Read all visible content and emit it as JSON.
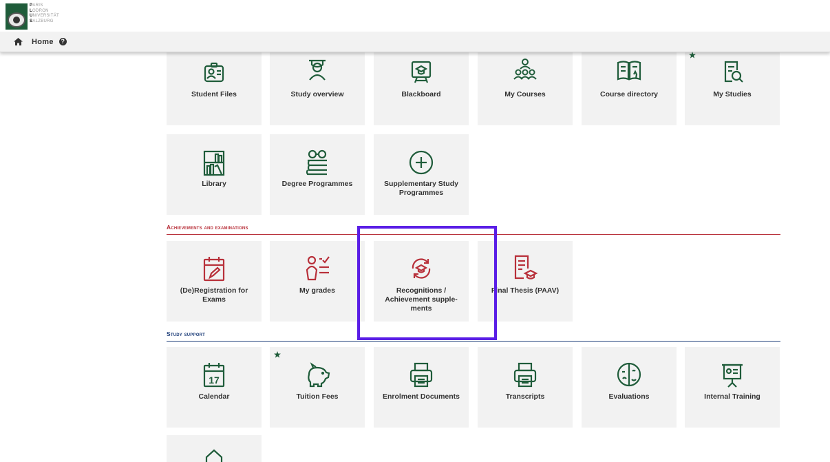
{
  "logo": {
    "letters": [
      "P",
      "L",
      "U",
      "S"
    ],
    "lines": [
      "ARIS",
      "ODRON",
      "NIVERSITÄT",
      "ALZBURG"
    ]
  },
  "nav": {
    "home_label": "Home",
    "help_symbol": "?"
  },
  "tiles_row1": [
    {
      "label": "Student Files",
      "icon": "student-id-icon"
    },
    {
      "label": "Study overview",
      "icon": "graduate-icon"
    },
    {
      "label": "Blackboard",
      "icon": "blackboard-icon"
    },
    {
      "label": "My Courses",
      "icon": "group-icon"
    },
    {
      "label": "Course directory",
      "icon": "open-book-icon"
    },
    {
      "label": "My Studies",
      "icon": "document-search-icon",
      "favourite": true
    }
  ],
  "tiles_row2": [
    {
      "label": "Library",
      "icon": "bookshelf-icon"
    },
    {
      "label": "Degree Programmes",
      "icon": "books-glasses-icon"
    },
    {
      "label": "Supplementary Study Programmes",
      "icon": "plus-circle-icon"
    }
  ],
  "section_achievements": {
    "title": "Achievements and examinations",
    "color": "#b8303a",
    "tiles": [
      {
        "label": "(De)Registration for Exams",
        "icon": "calendar-edit-icon"
      },
      {
        "label": "My grades",
        "icon": "person-checklist-icon"
      },
      {
        "label": "Recognitions / Achievement supple-ments",
        "icon": "recognition-cycle-icon"
      },
      {
        "label": "Final Thesis (PAAV)",
        "icon": "thesis-document-icon"
      }
    ]
  },
  "section_support": {
    "title": "Study support",
    "color": "#1f3f7a",
    "tiles": [
      {
        "label": "Calendar",
        "icon": "calendar-17-icon",
        "day": "17"
      },
      {
        "label": "Tuition Fees",
        "icon": "piggy-bank-icon",
        "favourite": true
      },
      {
        "label": "Enrolment Documents",
        "icon": "printer-icon"
      },
      {
        "label": "Transcripts",
        "icon": "printer-icon"
      },
      {
        "label": "Evaluations",
        "icon": "evaluation-face-icon"
      },
      {
        "label": "Internal Training",
        "icon": "presentation-board-icon"
      }
    ]
  },
  "colors": {
    "accent_green": "#1f5c3a",
    "accent_red": "#b8303a",
    "accent_blue": "#1f3f7a",
    "highlight": "#5a1ee6",
    "tile_bg": "#f2f2f2"
  }
}
